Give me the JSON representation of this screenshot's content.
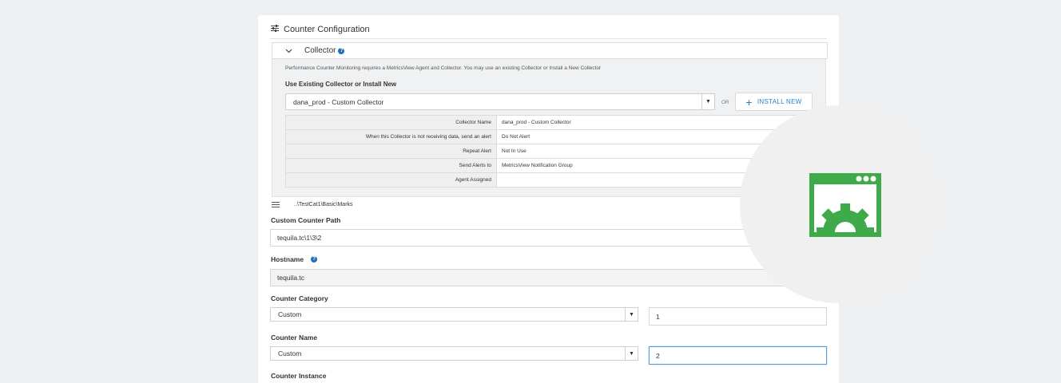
{
  "section": {
    "title": "Counter Configuration"
  },
  "collector": {
    "header_label": "Collector",
    "help_glyph": "?",
    "info_text": "Performance Counter Monitoring requires a MetricsView Agent and Collector. You may use an existing Collector or Install a New Collector",
    "use_label": "Use Existing Collector or Install New",
    "selected": "dana_prod - Custom Collector",
    "or_text": "OR",
    "install_label": "INSTALL NEW",
    "rows": [
      {
        "key": "Collector Name",
        "value": "dana_prod - Custom Collector"
      },
      {
        "key": "When this Collector is not receiving data, send an alert",
        "value": "Do Not Alert"
      },
      {
        "key": "Repeat Alert",
        "value": "Not In Use"
      },
      {
        "key": "Send Alerts to",
        "value": "MetricsView Notification Group"
      },
      {
        "key": "Agent Assigned",
        "value": ""
      }
    ]
  },
  "path_display": "..\\TestCat1\\Basic\\Marks",
  "fields": {
    "custom_path_label": "Custom Counter Path",
    "custom_path_value": "tequila.tc\\1\\3\\2",
    "hostname_label": "Hostname",
    "hostname_value": "tequila.tc",
    "category_label": "Counter Category",
    "category_select": "Custom",
    "category_input": "1",
    "name_label": "Counter Name",
    "name_select": "Custom",
    "name_input": "2",
    "instance_label": "Counter Instance"
  },
  "colors": {
    "accent_green": "#3faa4a",
    "link_blue": "#2a7fc9",
    "help_blue": "#1f6fb5"
  }
}
